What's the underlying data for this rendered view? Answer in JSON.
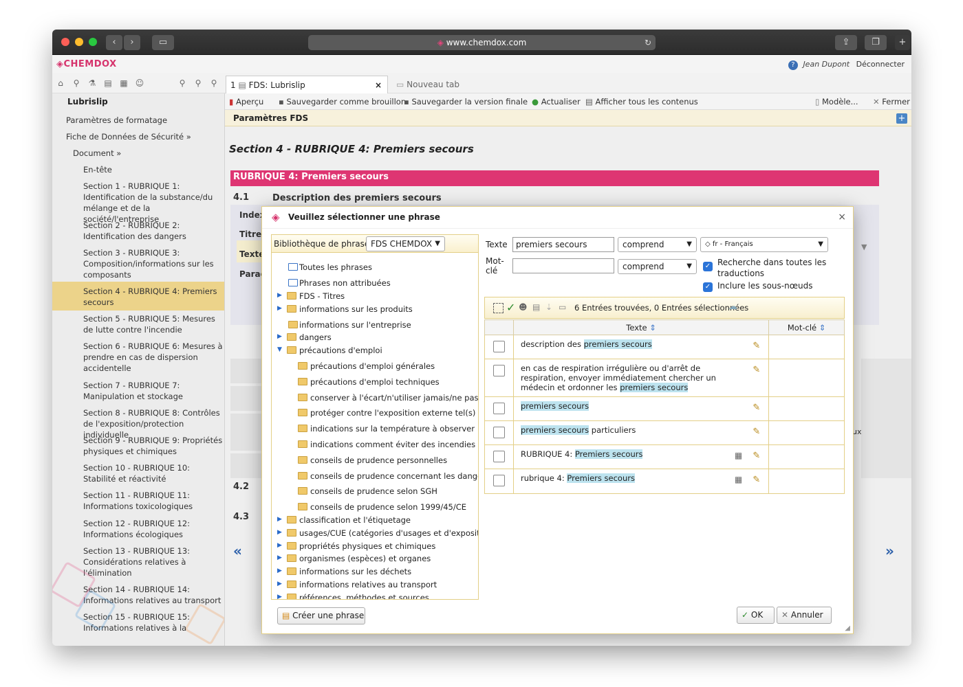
{
  "browser": {
    "url": "www.chemdox.com",
    "back_icon": "chevron-left-icon",
    "forward_icon": "chevron-right-icon"
  },
  "app": {
    "logo": "CHEMDOX",
    "user": "Jean Dupont",
    "logout": "Déconnecter"
  },
  "tabs": [
    {
      "label": "FDS: Lubrislip",
      "index": "1"
    },
    {
      "label": "Nouveau tab"
    }
  ],
  "actions": {
    "apercu": "Aperçu",
    "brouillon": "Sauvegarder comme brouillon",
    "finale": "Sauvegarder la version finale",
    "actualiser": "Actualiser",
    "afficher": "Afficher tous les contenus",
    "modele": "Modèle...",
    "fermer": "Fermer"
  },
  "sidebar": {
    "title": "Lubrislip",
    "items": [
      "Paramètres de formatage",
      "Fiche de Données de Sécurité »",
      "Document »",
      "En-tête",
      "Section 1 - RUBRIQUE 1: Identification de la substance/du mélange et de la société/l'entreprise",
      "Section 2 - RUBRIQUE 2: Identification des dangers",
      "Section 3 - RUBRIQUE 3: Composition/informations sur les composants",
      "Section 4 - RUBRIQUE 4: Premiers secours",
      "Section 5 - RUBRIQUE 5: Mesures de lutte contre l'incendie",
      "Section 6 - RUBRIQUE 6: Mesures à prendre en cas de dispersion accidentelle",
      "Section 7 - RUBRIQUE 7: Manipulation et stockage",
      "Section 8 - RUBRIQUE 8: Contrôles de l'exposition/protection individuelle",
      "Section 9 - RUBRIQUE 9: Propriétés physiques et chimiques",
      "Section 10 - RUBRIQUE 10: Stabilité et réactivité",
      "Section 11 - RUBRIQUE 11: Informations toxicologiques",
      "Section 12 - RUBRIQUE 12: Informations écologiques",
      "Section 13 - RUBRIQUE 13: Considérations relatives à l'élimination",
      "Section 14 - RUBRIQUE 14: Informations relatives au transport",
      "Section 15 - RUBRIQUE 15: Informations relatives à la"
    ]
  },
  "main": {
    "param_header": "Paramètres FDS",
    "section_title": "Section 4 - RUBRIQUE 4: Premiers secours",
    "rubrique_bar": "RUBRIQUE 4: Premiers secours",
    "sub_41_num": "4.1",
    "sub_41_label": "Description des premiers secours",
    "sub_42_num": "4.2",
    "sub_43_num": "4.3",
    "field_index": "Index",
    "field_titre": "Titre",
    "field_texte": "Texte",
    "field_parag": "Parag",
    "trunc": "ux"
  },
  "dialog": {
    "title": "Veuillez sélectionner une phrase",
    "library_label": "Bibliothèque de phrases:",
    "library_value": "FDS CHEMDOX",
    "tree": [
      "Toutes les phrases",
      "Phrases non attribuées",
      "FDS - Titres",
      "informations sur les produits",
      "informations sur l'entreprise",
      "dangers",
      "précautions d'emploi",
      "précautions d'emploi générales",
      "précautions d'emploi techniques",
      "conserver à l'écart/n'utiliser jamais/ne pas mélar",
      "protéger contre l'exposition externe tel(s) que",
      "indications sur la température à observer",
      "indications comment éviter des incendies et des",
      "conseils de prudence personnelles",
      "conseils de prudence concernant les dangers pc",
      "conseils de prudence selon SGH",
      "conseils de prudence selon 1999/45/CE",
      "classification et l'étiquetage",
      "usages/CUE (catégories d'usages et d'expositions)",
      "propriétés physiques et chimiques",
      "organismes (espèces) et organes",
      "informations sur les déchets",
      "informations relatives au transport",
      "références, méthodes et sources"
    ],
    "search": {
      "texte_label": "Texte",
      "texte_value": "premiers secours",
      "texte_mode": "comprend",
      "lang": "◇ fr - Français",
      "motcle_label1": "Mot-",
      "motcle_label2": "clé",
      "motcle_value": "",
      "motcle_mode": "comprend",
      "all_translations1": "Recherche dans toutes les",
      "all_translations2": "traductions",
      "subnodes": "Inclure les sous-nœuds"
    },
    "results_summary": "6 Entrées trouvées, 0 Entrées sélectionnées",
    "col_texte": "Texte",
    "col_motcle": "Mot-clé",
    "rows": [
      {
        "pre": "description des ",
        "h1": "premiers",
        "h2": "secours",
        "post": ""
      },
      {
        "pre": "en cas de respiration irrégulière ou d'arrêt de respiration, envoyer immédiatement chercher un médecin et ordonner les ",
        "h1": "premiers",
        "h2": "secours",
        "post": ""
      },
      {
        "pre": "",
        "h1": "premiers",
        "h2": "secours",
        "post": ""
      },
      {
        "pre": "",
        "h1": "premiers",
        "h2": "secours",
        "post": " particuliers"
      },
      {
        "pre": "RUBRIQUE 4: ",
        "h1": "Premiers",
        "h2": "secours",
        "post": ""
      },
      {
        "pre": "rubrique 4: ",
        "h1": "Premiers",
        "h2": "secours",
        "post": ""
      }
    ],
    "create_btn": "Créer une phrase",
    "ok_btn": "OK",
    "cancel_btn": "Annuler"
  }
}
